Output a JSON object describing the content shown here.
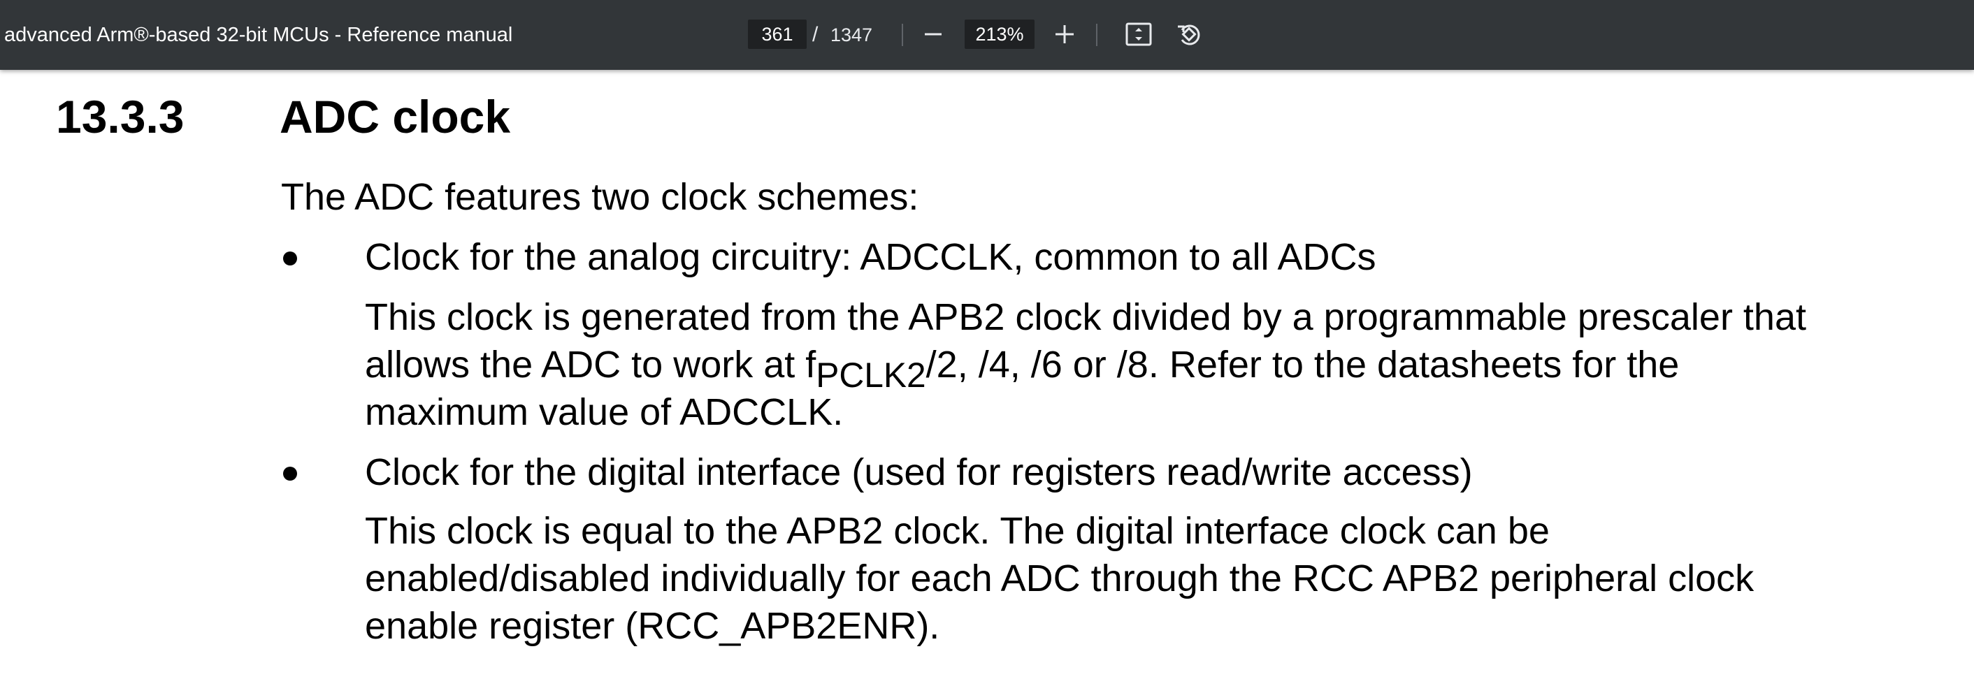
{
  "toolbar": {
    "doc_title": "advanced Arm®-based 32-bit MCUs - Reference manual",
    "page_current": "361",
    "page_separator": "/",
    "page_total": "1347",
    "zoom_out_icon": "minus-icon",
    "zoom_value": "213%",
    "zoom_in_icon": "plus-icon",
    "fit_icon": "fit-page-icon",
    "rotate_icon": "rotate-icon"
  },
  "document": {
    "section_number": "13.3.3",
    "section_title": "ADC clock",
    "intro": "The ADC features two clock schemes:",
    "bullet1": {
      "heading": "Clock for the analog circuitry: ADCCLK, common to all ADCs",
      "line1": "This clock is generated from the APB2 clock divided by a programmable prescaler that",
      "line2_pre": "allows the ADC to work at f",
      "line2_sub": "PCLK2",
      "line2_post": "/2, /4, /6 or /8. Refer to the datasheets for the",
      "line3": "maximum value of ADCCLK."
    },
    "bullet2": {
      "heading": "Clock for the digital interface (used for registers read/write access)",
      "line1": "This clock is equal to the APB2 clock. The digital interface clock can be",
      "line2": "enabled/disabled individually for each ADC through the RCC APB2 peripheral clock",
      "line3": "enable register (RCC_APB2ENR)."
    }
  }
}
